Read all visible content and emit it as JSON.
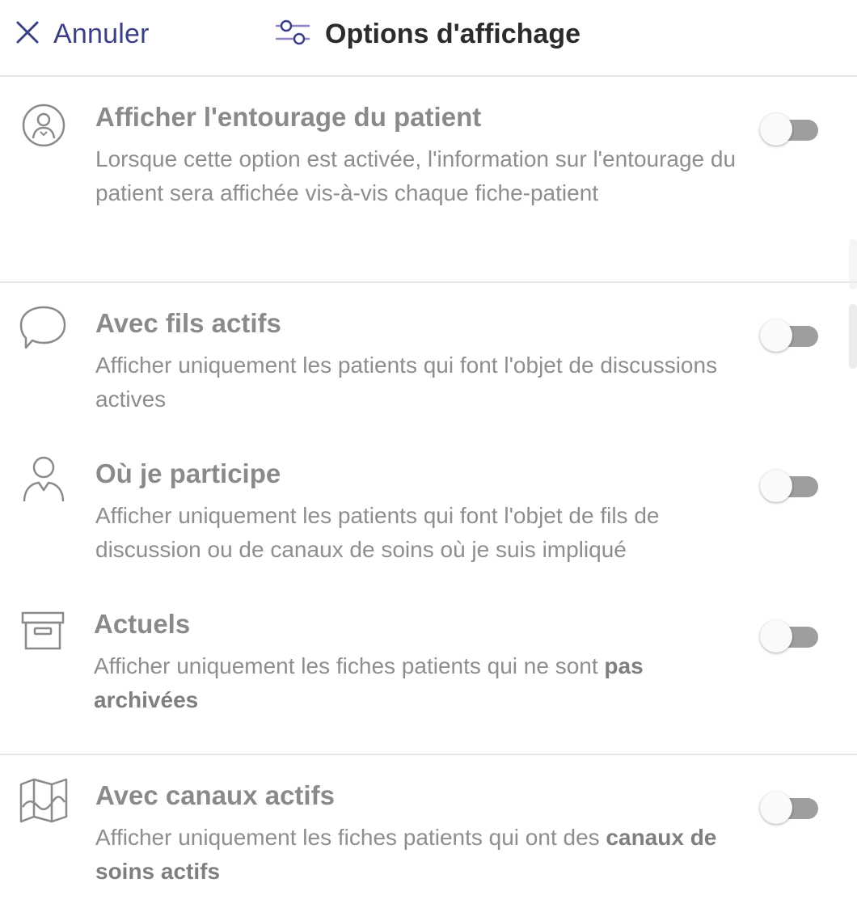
{
  "header": {
    "cancel_label": "Annuler",
    "title": "Options d'affichage"
  },
  "options": [
    {
      "icon": "person-circle-icon",
      "title": "Afficher l'entourage du patient",
      "description": "Lorsque cette option est activée, l'information sur l'entourage du patient sera affichée vis-à-vis chaque fiche-patient",
      "enabled": false
    },
    {
      "icon": "chat-bubble-icon",
      "title": "Avec fils actifs",
      "description": "Afficher uniquement les patients qui font l'objet de discussions actives",
      "enabled": false
    },
    {
      "icon": "participant-icon",
      "title": "Où je participe",
      "description": "Afficher uniquement les patients qui font l'objet de fils de discussion ou de canaux de soins où je suis impliqué",
      "enabled": false
    },
    {
      "icon": "archive-box-icon",
      "title": "Actuels",
      "description_prefix": "Afficher uniquement les fiches patients qui ne sont ",
      "description_bold": "pas archivées",
      "enabled": false
    },
    {
      "icon": "map-icon",
      "title": "Avec canaux actifs",
      "description_prefix": "Afficher uniquement les fiches patients qui ont des ",
      "description_bold": "canaux de soins actifs",
      "enabled": false
    }
  ],
  "colors": {
    "accent": "#3b3f86",
    "title_text": "#2b2b2b",
    "muted_text": "#8a8a8a",
    "toggle_track_off": "#9e9e9e",
    "divider": "#e6e6e6"
  }
}
